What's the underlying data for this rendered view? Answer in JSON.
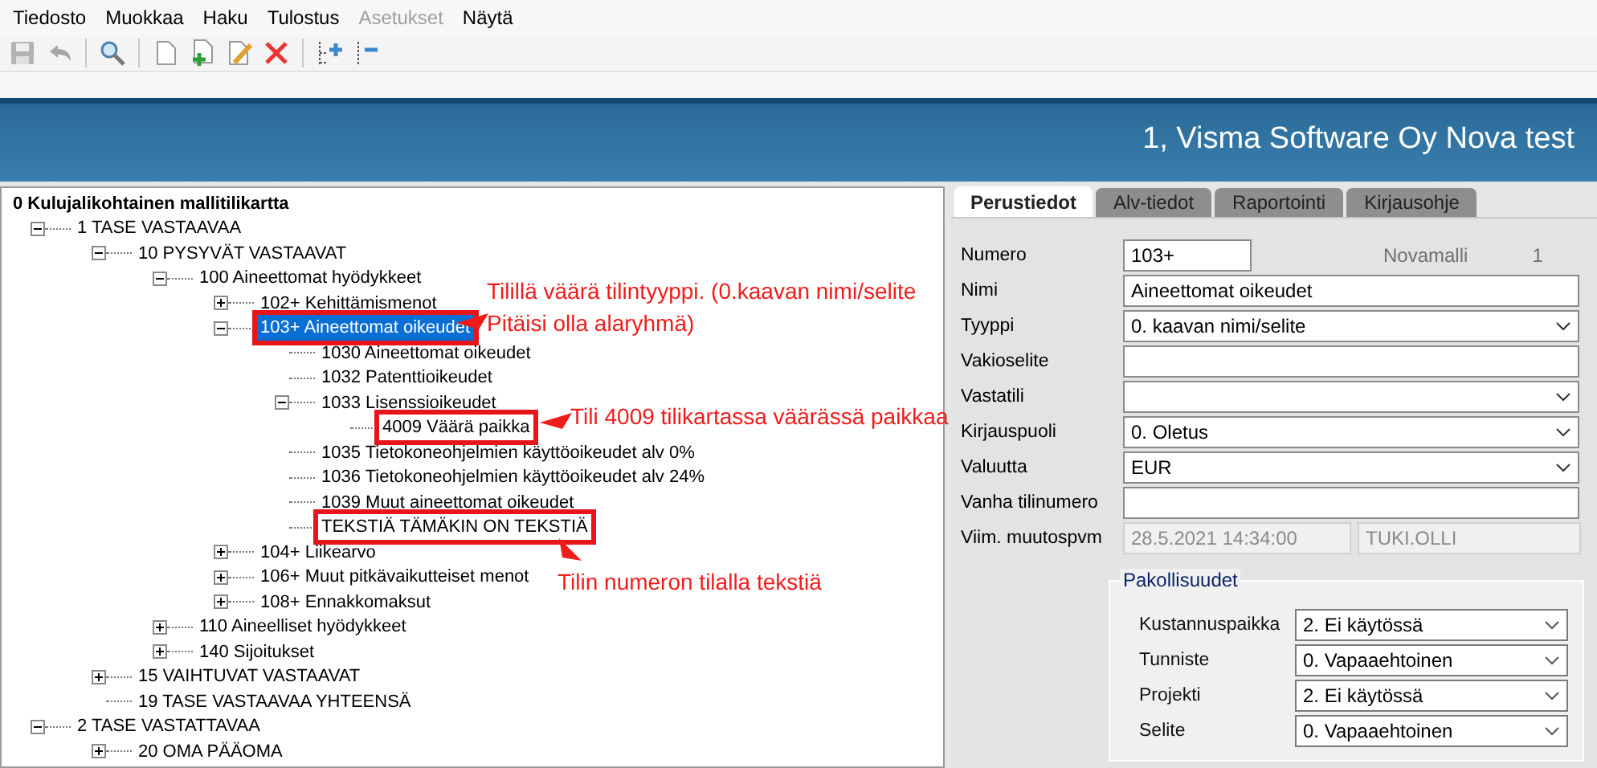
{
  "menu": [
    {
      "label": "Tiedosto",
      "disabled": false
    },
    {
      "label": "Muokkaa",
      "disabled": false
    },
    {
      "label": "Haku",
      "disabled": false
    },
    {
      "label": "Tulostus",
      "disabled": false
    },
    {
      "label": "Asetukset",
      "disabled": true
    },
    {
      "label": "Näytä",
      "disabled": false
    }
  ],
  "toolbar": [
    {
      "kind": "save",
      "disabled": true
    },
    {
      "kind": "undo",
      "disabled": true
    },
    {
      "kind": "sep"
    },
    {
      "kind": "search",
      "disabled": false
    },
    {
      "kind": "sep"
    },
    {
      "kind": "new",
      "disabled": false
    },
    {
      "kind": "add",
      "disabled": false
    },
    {
      "kind": "edit",
      "disabled": false
    },
    {
      "kind": "delete",
      "disabled": false
    },
    {
      "kind": "sep"
    },
    {
      "kind": "tree-add",
      "disabled": false
    },
    {
      "kind": "tree-remove",
      "disabled": false
    }
  ],
  "header": {
    "title": "1, Visma Software Oy Nova test"
  },
  "tree": {
    "label": "0 Kulujalikohtainen mallitilikartta",
    "selected": false,
    "flagged": false,
    "children": [
      {
        "label": "1 TASE VASTAAVAA",
        "expanded": true,
        "selected": false,
        "flagged": false,
        "children": [
          {
            "label": "10 PYSYVÄT VASTAAVAT",
            "expanded": true,
            "selected": false,
            "flagged": false,
            "children": [
              {
                "label": "100 Aineettomat hyödykkeet",
                "expanded": true,
                "selected": false,
                "flagged": false,
                "children": [
                  {
                    "label": "102+ Kehittämismenot",
                    "expanded": false,
                    "selected": false,
                    "flagged": false
                  },
                  {
                    "label": "103+ Aineettomat oikeudet",
                    "expanded": true,
                    "selected": true,
                    "flagged": true,
                    "children": [
                      {
                        "label": "1030 Aineettomat oikeudet",
                        "selected": false,
                        "flagged": false
                      },
                      {
                        "label": "1032 Patenttioikeudet",
                        "selected": false,
                        "flagged": false
                      },
                      {
                        "label": "1033 Lisenssioikeudet",
                        "expanded": true,
                        "selected": false,
                        "flagged": false,
                        "children": [
                          {
                            "label": "4009 Väärä paikka",
                            "selected": false,
                            "flagged": true
                          }
                        ]
                      },
                      {
                        "label": "1035 Tietokoneohjelmien käyttöoikeudet alv 0%",
                        "selected": false,
                        "flagged": false
                      },
                      {
                        "label": "1036 Tietokoneohjelmien käyttöoikeudet alv 24%",
                        "selected": false,
                        "flagged": false
                      },
                      {
                        "label": "1039 Muut aineettomat oikeudet",
                        "selected": false,
                        "flagged": false
                      },
                      {
                        "label": "TEKSTIÄ TÄMÄKIN ON TEKSTIÄ",
                        "selected": false,
                        "flagged": true
                      }
                    ]
                  },
                  {
                    "label": "104+ Liikearvo",
                    "expanded": false,
                    "selected": false,
                    "flagged": false
                  },
                  {
                    "label": "106+ Muut pitkävaikutteiset menot",
                    "expanded": false,
                    "selected": false,
                    "flagged": false
                  },
                  {
                    "label": "108+ Ennakkomaksut",
                    "expanded": false,
                    "selected": false,
                    "flagged": false
                  }
                ]
              },
              {
                "label": "110 Aineelliset hyödykkeet",
                "expanded": false,
                "selected": false,
                "flagged": false
              },
              {
                "label": "140 Sijoitukset",
                "expanded": false,
                "selected": false,
                "flagged": false
              }
            ]
          },
          {
            "label": "15 VAIHTUVAT VASTAAVAT",
            "expanded": false,
            "selected": false,
            "flagged": false
          },
          {
            "label": "19 TASE VASTAAVAA YHTEENSÄ",
            "selected": false,
            "flagged": false
          }
        ]
      },
      {
        "label": "2 TASE VASTATTAVAA",
        "expanded": true,
        "selected": false,
        "flagged": false,
        "children": [
          {
            "label": "20 OMA PÄÄOMA",
            "expanded": false,
            "selected": false,
            "flagged": false
          }
        ]
      }
    ]
  },
  "annotations": [
    {
      "lines": [
        "Tilillä väärä tilintyyppi. (0.kaavan nimi/selite",
        "Pitäisi olla alaryhmä)"
      ]
    },
    {
      "lines": [
        "Tili 4009 tilikartassa väärässä paikkaa"
      ]
    },
    {
      "lines": [
        "Tilin numeron tilalla tekstiä"
      ]
    }
  ],
  "tabs": [
    {
      "label": "Perustiedot",
      "selected": true
    },
    {
      "label": "Alv-tiedot",
      "selected": false
    },
    {
      "label": "Raportointi",
      "selected": false
    },
    {
      "label": "Kirjausohje",
      "selected": false
    }
  ],
  "form": [
    {
      "label": "Numero",
      "kind": "short",
      "value": "103+",
      "note": {
        "label": "Novamalli",
        "value": "1"
      }
    },
    {
      "label": "Nimi",
      "kind": "text",
      "value": "Aineettomat oikeudet"
    },
    {
      "label": "Tyyppi",
      "kind": "select",
      "value": "0. kaavan nimi/selite"
    },
    {
      "label": "Vakioselite",
      "kind": "text"
    },
    {
      "label": "Vastatili",
      "kind": "select"
    },
    {
      "label": "Kirjauspuoli",
      "kind": "select",
      "value": "0. Oletus"
    },
    {
      "label": "Valuutta",
      "kind": "select",
      "value": "EUR"
    },
    {
      "label": "Vanha tilinumero",
      "kind": "text"
    },
    {
      "label": "Viim. muutospvm",
      "kind": "readonly-pair",
      "values": [
        "28.5.2021 14:34:00",
        "TUKI.OLLI"
      ]
    }
  ],
  "required": {
    "title": "Pakollisuudet",
    "fields": [
      {
        "label": "Kustannuspaikka",
        "value": "2. Ei käytössä"
      },
      {
        "label": "Tunniste",
        "value": "0. Vapaaehtoinen"
      },
      {
        "label": "Projekti",
        "value": "2. Ei käytössä"
      },
      {
        "label": "Selite",
        "value": "0. Vapaaehtoinen"
      }
    ]
  }
}
